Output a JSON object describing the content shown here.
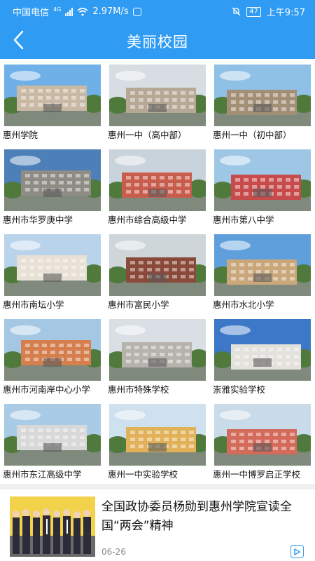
{
  "status_bar": {
    "carrier": "中国电信",
    "network": "4G",
    "speed": "2.97M/s",
    "battery": "47",
    "time": "上午9:57"
  },
  "header": {
    "title": "美丽校园",
    "back_icon": "chevron-left-icon"
  },
  "colors": {
    "primary": "#2f9bf3",
    "divider": "#eef0f2"
  },
  "schools": [
    {
      "name": "惠州学院",
      "sky": "#6fb0e8",
      "building": "#c9b8a3"
    },
    {
      "name": "惠州一中（高中部）",
      "sky": "#d7dde3",
      "building": "#b7a895"
    },
    {
      "name": "惠州一中（初中部）",
      "sky": "#8fc0e6",
      "building": "#a38f76"
    },
    {
      "name": "惠州市华罗庚中学",
      "sky": "#4d7fb8",
      "building": "#8f8c86"
    },
    {
      "name": "惠州市综合高级中学",
      "sky": "#c9d3dc",
      "building": "#c85d4d"
    },
    {
      "name": "惠州市第八中学",
      "sky": "#9ec7e6",
      "building": "#c84b4b"
    },
    {
      "name": "惠州市南坛小学",
      "sky": "#b9d3ea",
      "building": "#e7e0d4"
    },
    {
      "name": "惠州市富民小学",
      "sky": "#cfd6da",
      "building": "#8a4a3a"
    },
    {
      "name": "惠州市水北小学",
      "sky": "#5f9fdc",
      "building": "#c9a77a"
    },
    {
      "name": "惠州市河南岸中心小学",
      "sky": "#a4c8e4",
      "building": "#d57e4e"
    },
    {
      "name": "惠州市特殊学校",
      "sky": "#d9dfe4",
      "building": "#b6b2ac"
    },
    {
      "name": "崇雅实验学校",
      "sky": "#3d78c8",
      "building": "#e3e1dc"
    },
    {
      "name": "惠州市东江高级中学",
      "sky": "#a9cbe6",
      "building": "#d8d8d8"
    },
    {
      "name": "惠州一中实验学校",
      "sky": "#cfe0ee",
      "building": "#e2b25a"
    },
    {
      "name": "惠州一中博罗启正学校",
      "sky": "#c9dbe9",
      "building": "#d46a5a"
    }
  ],
  "news": {
    "headline": "全国政协委员杨勋到惠州学院宣读全国“两会”精神",
    "date": "06-26",
    "thumb_bg": "#f2d24a",
    "video_icon": "play-icon"
  }
}
